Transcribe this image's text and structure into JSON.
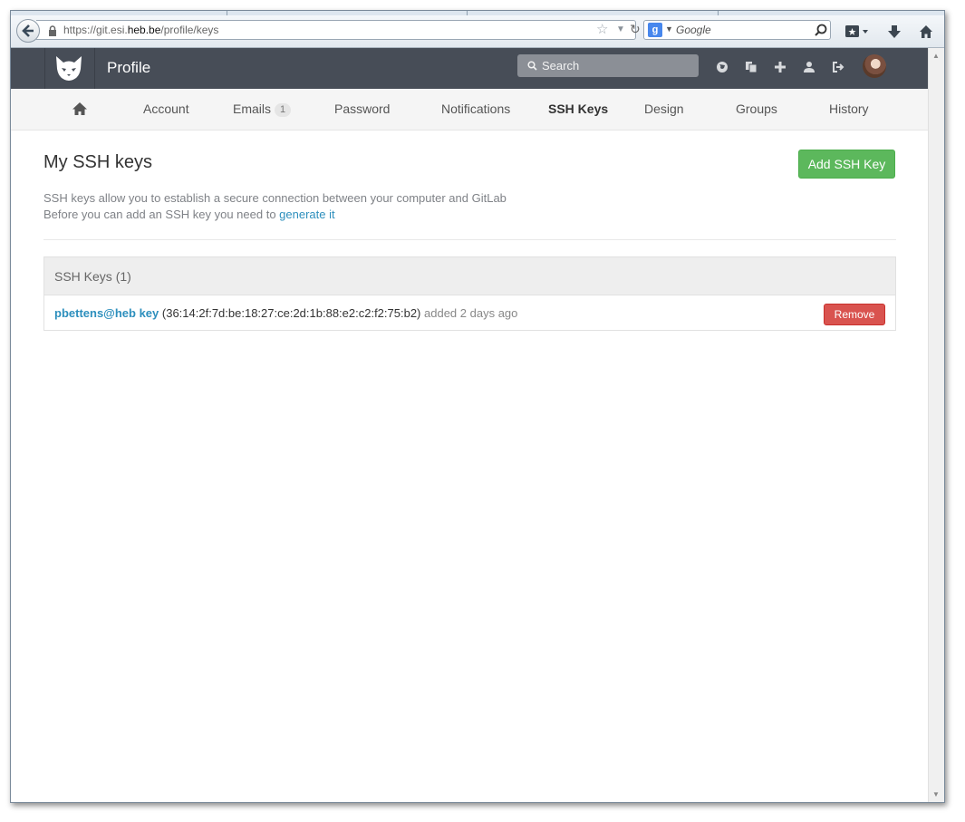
{
  "browser": {
    "url_prefix": "https://git.esi.",
    "url_domain": "heb.be",
    "url_path": "/profile/keys",
    "search_engine_letter": "g",
    "search_placeholder": "Google"
  },
  "header": {
    "title": "Profile",
    "search_placeholder": "Search"
  },
  "nav": {
    "items": [
      {
        "label": "Account"
      },
      {
        "label": "Emails",
        "badge": "1"
      },
      {
        "label": "Password"
      },
      {
        "label": "Notifications"
      },
      {
        "label": "SSH Keys",
        "active": true
      },
      {
        "label": "Design"
      },
      {
        "label": "Groups"
      },
      {
        "label": "History"
      }
    ]
  },
  "page": {
    "title": "My SSH keys",
    "add_button": "Add SSH Key",
    "desc_line1": "SSH keys allow you to establish a secure connection between your computer and GitLab",
    "desc_line2_prefix": "Before you can add an SSH key you need to ",
    "desc_line2_link": "generate it"
  },
  "keys_panel": {
    "title": "SSH Keys (1)",
    "keys": [
      {
        "name": "pbettens@heb key",
        "fingerprint": "(36:14:2f:7d:be:18:27:ce:2d:1b:88:e2:c2:f2:75:b2)",
        "added": "added 2 days ago",
        "remove_label": "Remove"
      }
    ]
  },
  "colors": {
    "header_bg": "#474d57",
    "add_button": "#5cb85c",
    "remove_button": "#d9534f",
    "link": "#2d8fbd"
  }
}
